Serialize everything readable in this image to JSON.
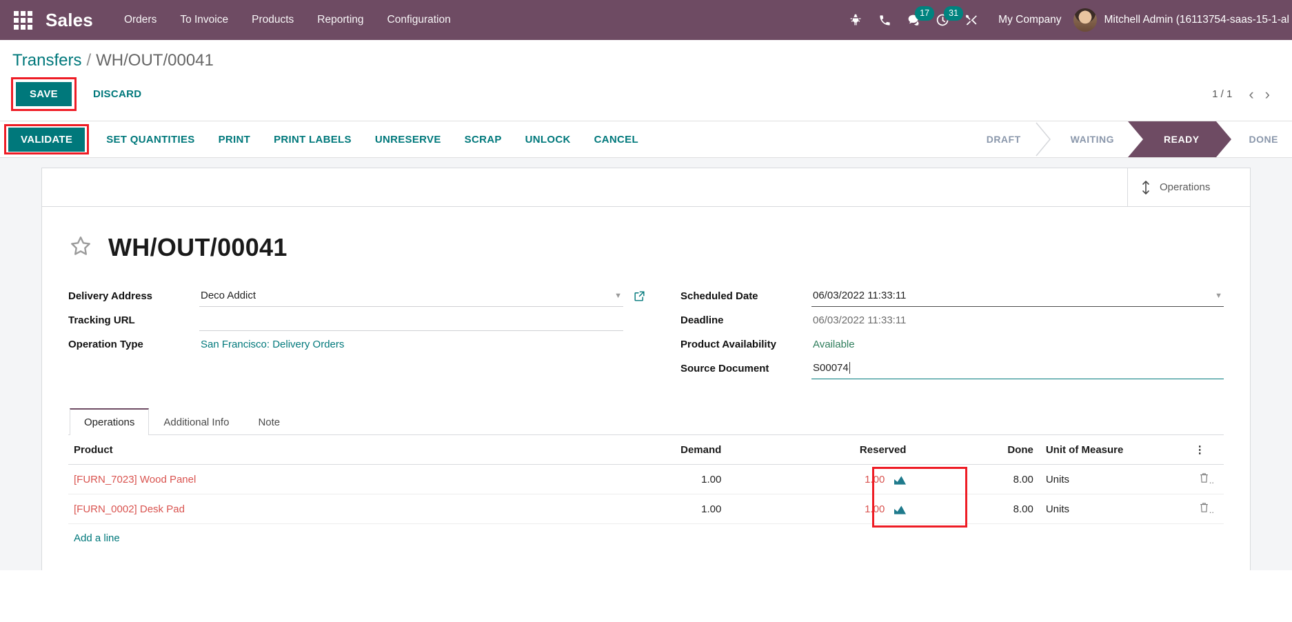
{
  "navbar": {
    "apps_icon": "apps-grid-icon",
    "brand": "Sales",
    "menu": [
      {
        "label": "Orders"
      },
      {
        "label": "To Invoice"
      },
      {
        "label": "Products"
      },
      {
        "label": "Reporting"
      },
      {
        "label": "Configuration"
      }
    ],
    "sys_icons": [
      {
        "name": "bug-icon",
        "badge": null
      },
      {
        "name": "phone-icon",
        "badge": null
      },
      {
        "name": "messages-icon",
        "badge": "17"
      },
      {
        "name": "activities-clock-icon",
        "badge": "31"
      },
      {
        "name": "tools-icon",
        "badge": null
      }
    ],
    "company": "My Company",
    "user": "Mitchell Admin (16113754-saas-15-1-al",
    "accent_color": "#6E4B63",
    "badge_color": "#00837F"
  },
  "breadcrumb": {
    "root": "Transfers",
    "separator": "/",
    "current": "WH/OUT/00041"
  },
  "toolbar": {
    "save_label": "SAVE",
    "discard_label": "DISCARD",
    "pager_count": "1 / 1",
    "prev_icon": "chevron-left-icon",
    "next_icon": "chevron-right-icon",
    "highlight_color": "#ee1c25",
    "button_color": "#00787B"
  },
  "action_bar": {
    "validate_label": "VALIDATE",
    "buttons": [
      {
        "label": "SET QUANTITIES"
      },
      {
        "label": "PRINT"
      },
      {
        "label": "PRINT LABELS"
      },
      {
        "label": "UNRESERVE"
      },
      {
        "label": "SCRAP"
      },
      {
        "label": "UNLOCK"
      },
      {
        "label": "CANCEL"
      }
    ],
    "statusbar": [
      {
        "label": "DRAFT",
        "active": false
      },
      {
        "label": "WAITING",
        "active": false
      },
      {
        "label": "READY",
        "active": true
      },
      {
        "label": "DONE",
        "active": false
      }
    ]
  },
  "sheet": {
    "smart_button": {
      "label": "Operations",
      "icon": "arrows-vertical-icon"
    },
    "star_icon": "star-outline-icon",
    "record_name": "WH/OUT/00041",
    "left_fields": [
      {
        "label": "Delivery Address",
        "value": "Deco Addict",
        "style": "text",
        "dropdown": true,
        "external": true
      },
      {
        "label": "Tracking URL",
        "value": "",
        "style": "text",
        "dropdown": false,
        "external": false
      },
      {
        "label": "Operation Type",
        "value": "San Francisco: Delivery Orders",
        "style": "link",
        "dropdown": false,
        "external": false
      }
    ],
    "right_fields": [
      {
        "label": "Scheduled Date",
        "value": "06/03/2022 11:33:11",
        "style": "text",
        "dropdown": true
      },
      {
        "label": "Deadline",
        "value": "06/03/2022 11:33:11",
        "style": "grey",
        "dropdown": false
      },
      {
        "label": "Product Availability",
        "value": "Available",
        "style": "green",
        "dropdown": false
      },
      {
        "label": "Source Document",
        "value": "S00074",
        "style": "editing",
        "dropdown": false
      }
    ],
    "tabs": [
      {
        "label": "Operations",
        "active": true
      },
      {
        "label": "Additional Info",
        "active": false
      },
      {
        "label": "Note",
        "active": false
      }
    ],
    "table": {
      "columns": [
        "Product",
        "Demand",
        "Reserved",
        "Done",
        "Unit of Measure"
      ],
      "optional_col_icon": "vertical-dots-icon",
      "rows": [
        {
          "product": "[FURN_7023] Wood Panel",
          "demand": "1.00",
          "reserved": "1.00",
          "reserved_icon": "chart-area-icon",
          "done": "8.00",
          "uom": "Units",
          "delete_icon": "trash-icon"
        },
        {
          "product": "[FURN_0002] Desk Pad",
          "demand": "1.00",
          "reserved": "1.00",
          "reserved_icon": "chart-area-icon",
          "done": "8.00",
          "uom": "Units",
          "delete_icon": "trash-icon"
        }
      ],
      "add_line_label": "Add a line"
    }
  }
}
